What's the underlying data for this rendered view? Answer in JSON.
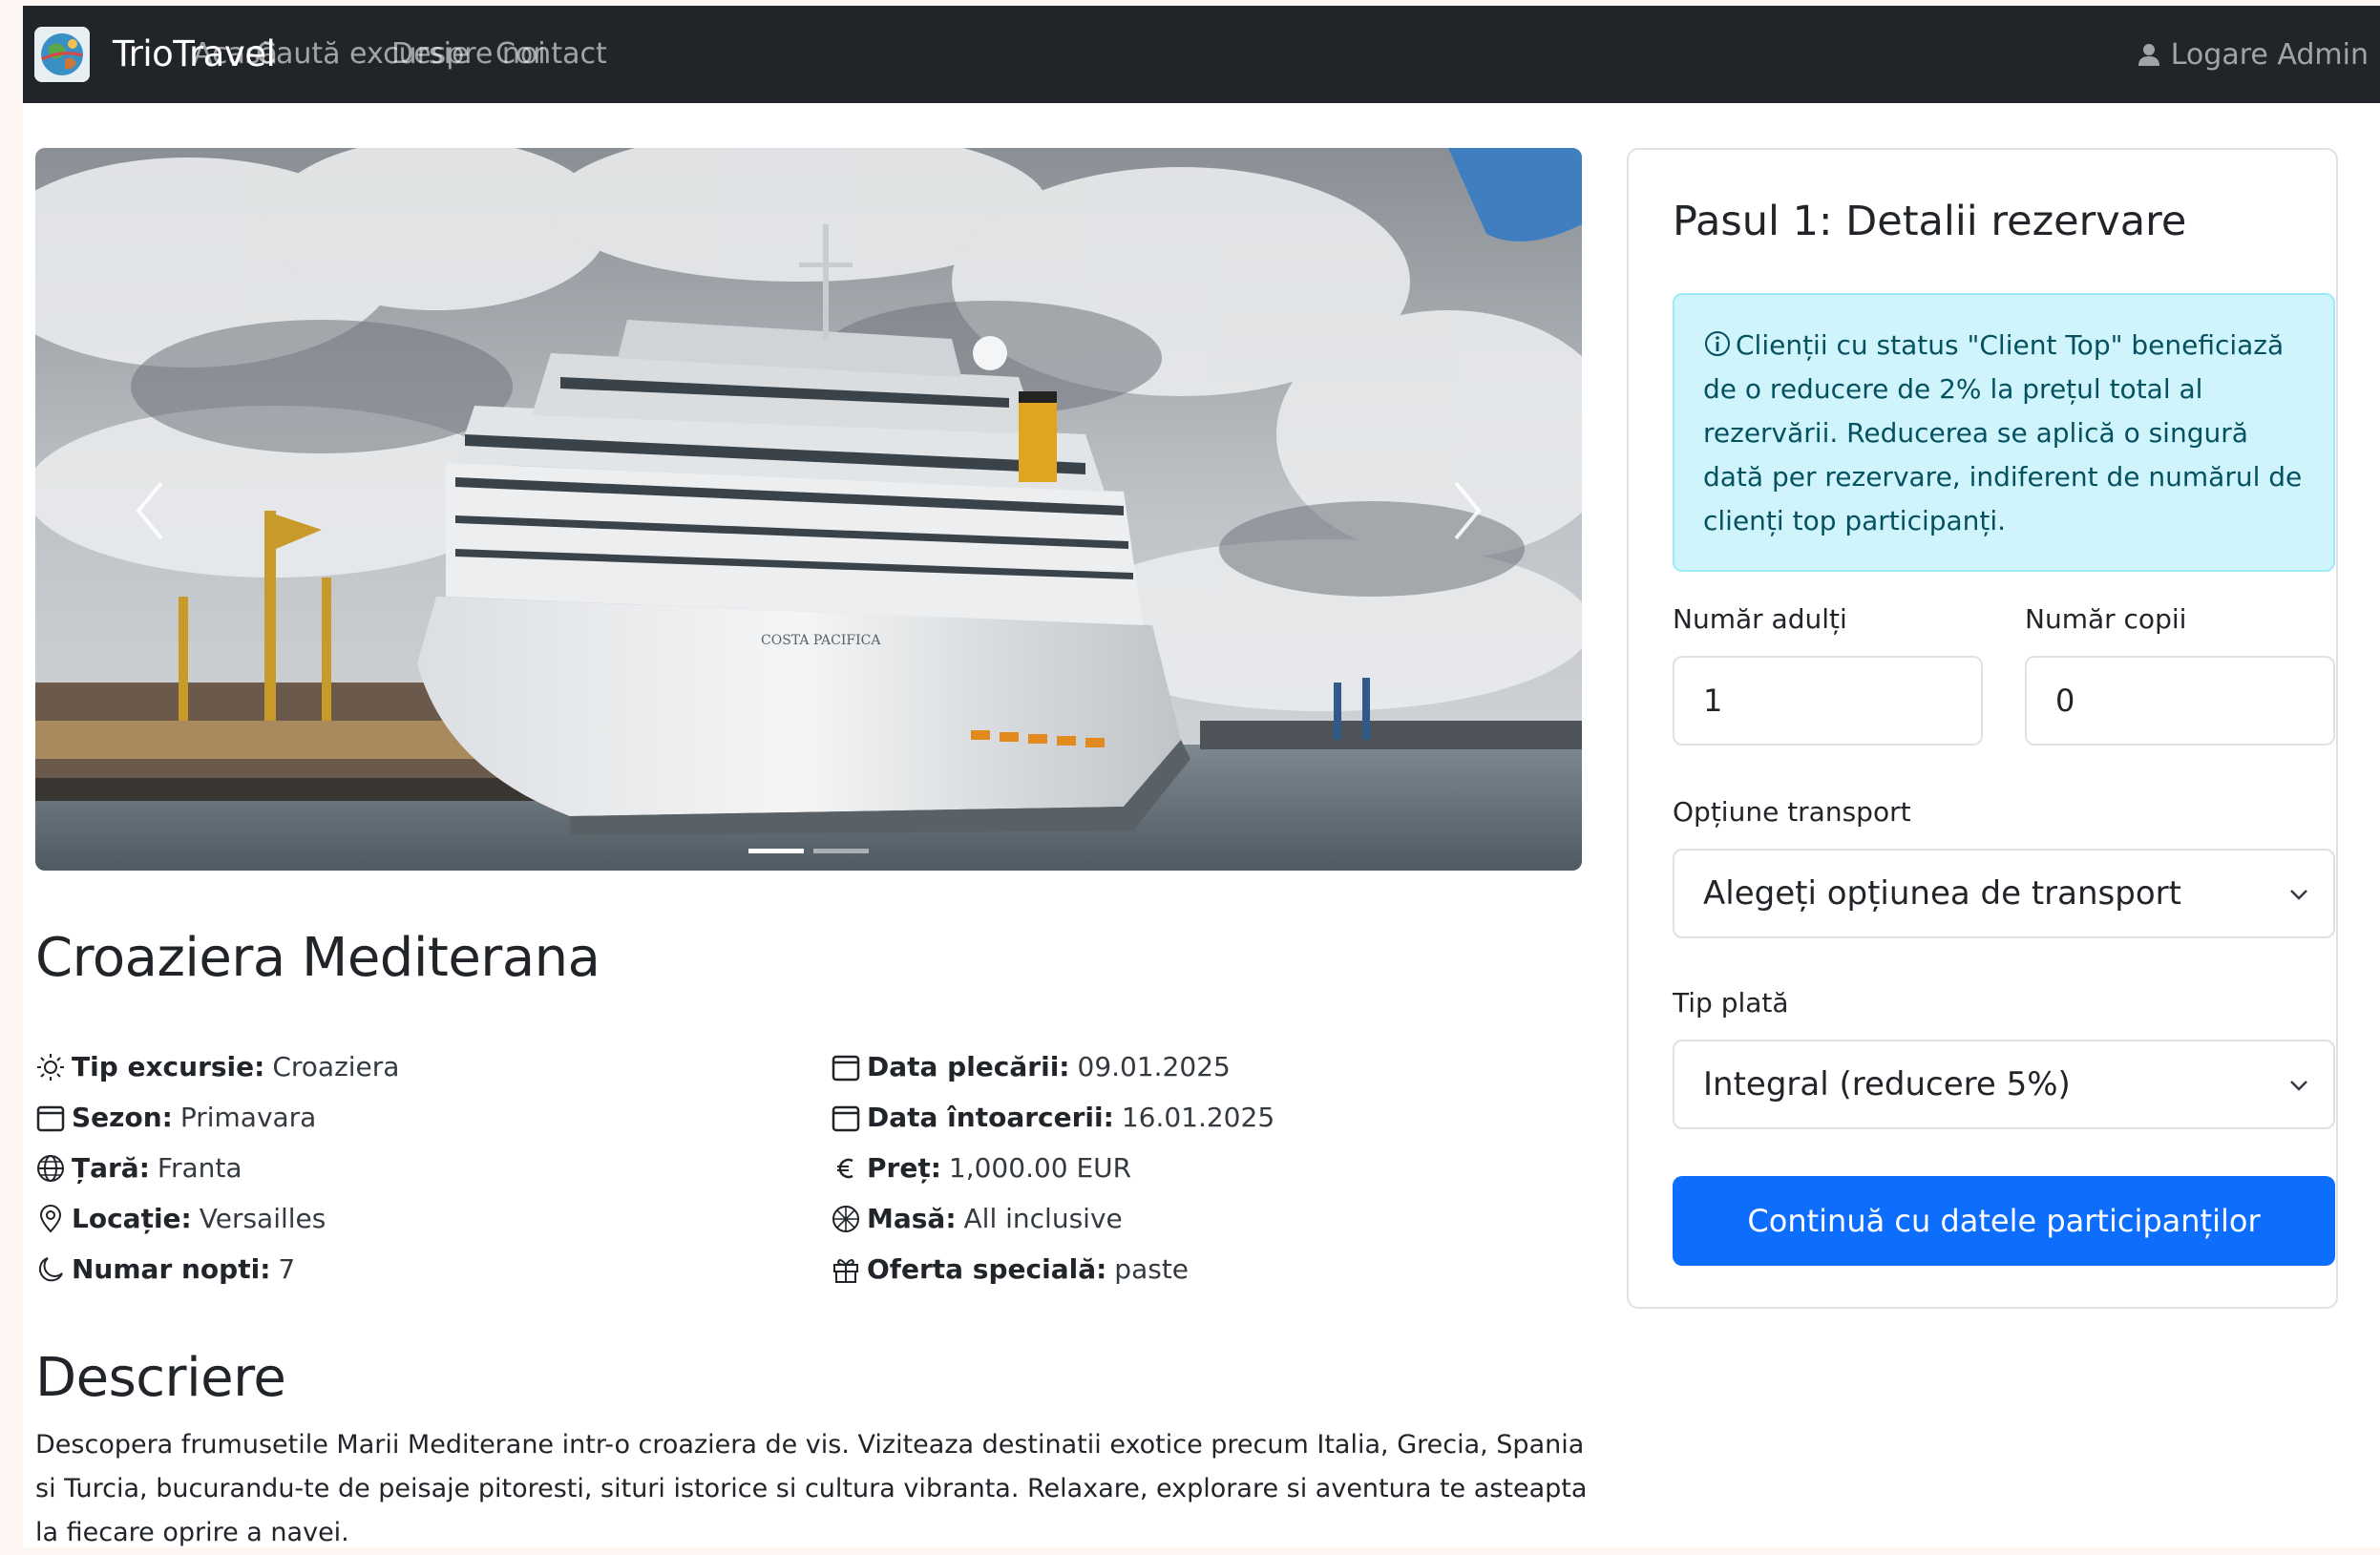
{
  "navbar": {
    "brand": "TrioTravel",
    "links": [
      "Acasă",
      "Caută excursie",
      "Despre noi",
      "Contact"
    ],
    "admin_login": "Logare Admin"
  },
  "carousel": {
    "slide_count": 2,
    "active_slide": 1,
    "ship_name": "COSTA PACIFICA"
  },
  "trip": {
    "title": "Croaziera Mediterana",
    "details_left": [
      {
        "icon": "sun-icon",
        "label": "Tip excursie:",
        "value": "Croaziera"
      },
      {
        "icon": "calendar-icon",
        "label": "Sezon:",
        "value": "Primavara"
      },
      {
        "icon": "globe-icon",
        "label": "Țară:",
        "value": "Franta"
      },
      {
        "icon": "location-pin-icon",
        "label": "Locație:",
        "value": "Versailles"
      },
      {
        "icon": "moon-icon",
        "label": "Numar nopti:",
        "value": "7"
      }
    ],
    "details_right": [
      {
        "icon": "calendar-icon",
        "label": "Data plecării:",
        "value": "09.01.2025"
      },
      {
        "icon": "calendar-icon",
        "label": "Data întoarcerii:",
        "value": "16.01.2025"
      },
      {
        "icon": "euro-icon",
        "label": "Preț:",
        "value": "1,000.00 EUR"
      },
      {
        "icon": "meal-icon",
        "label": "Masă:",
        "value": "All inclusive"
      },
      {
        "icon": "gift-icon",
        "label": "Oferta specială:",
        "value": "paste"
      }
    ],
    "description_heading": "Descriere",
    "description": "Descopera frumusetile Marii Mediterane intr-o croaziera de vis. Viziteaza destinatii exotice precum Italia, Grecia, Spania si Turcia, bucurandu-te de peisaje pitoresti, situri istorice si cultura vibranta. Relaxare, explorare si aventura te asteapta la fiecare oprire a navei."
  },
  "booking": {
    "title": "Pasul 1: Detalii rezervare",
    "info_alert": "Clienții cu status \"Client Top\" beneficiază de o reducere de 2% la prețul total al rezervării. Reducerea se aplică o singură dată per rezervare, indiferent de numărul de clienți top participanți.",
    "adults_label": "Număr adulți",
    "adults_value": "1",
    "children_label": "Număr copii",
    "children_value": "0",
    "transport_label": "Opțiune transport",
    "transport_selected": "Alegeți opțiunea de transport",
    "payment_label": "Tip plată",
    "payment_selected": "Integral (reducere 5%)",
    "continue_button": "Continuă cu datele participanților"
  },
  "colors": {
    "navbar_bg": "#212529",
    "primary": "#0d6efd",
    "alert_bg": "#cff4fc",
    "alert_text": "#055160"
  }
}
